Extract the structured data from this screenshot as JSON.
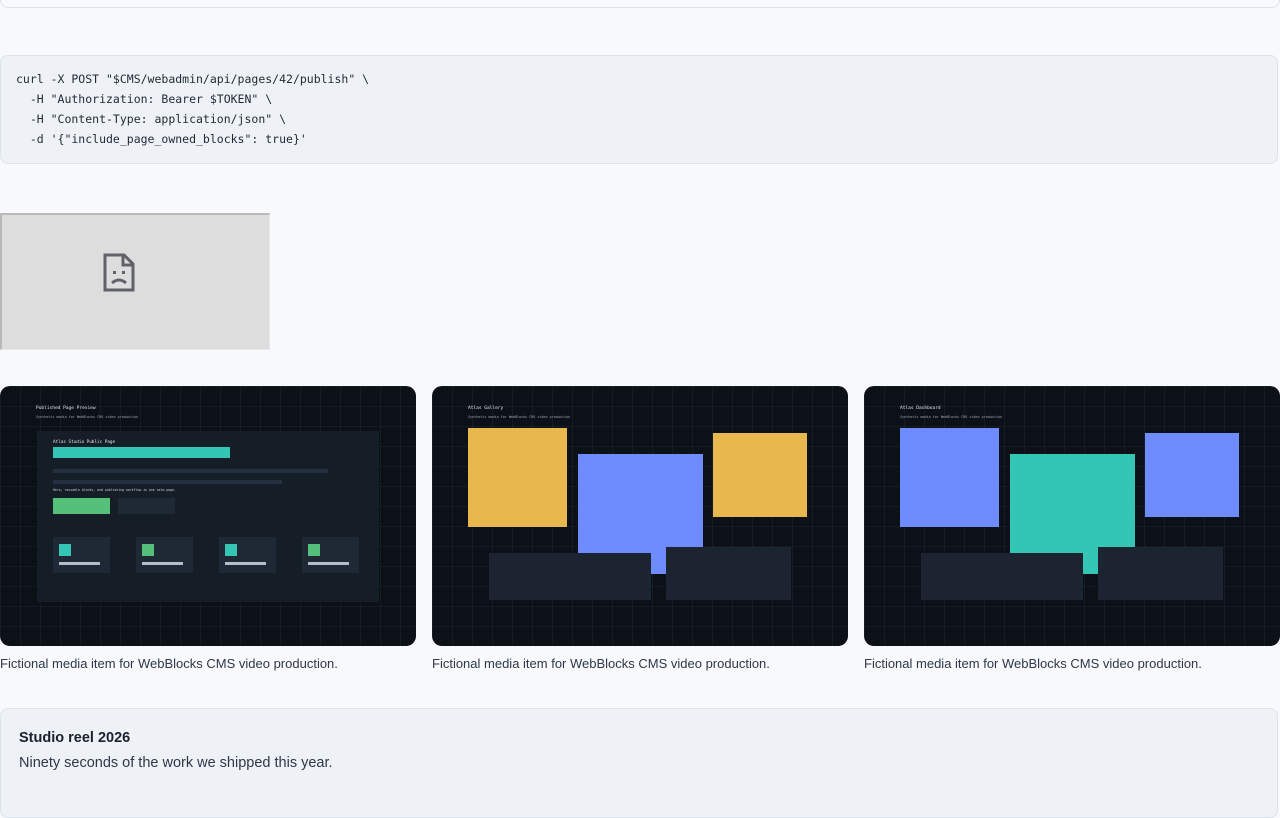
{
  "code_snippet": {
    "lines": [
      "curl -X POST \"$CMS/webadmin/api/pages/42/publish\" \\",
      "  -H \"Authorization: Bearer $TOKEN\" \\",
      "  -H \"Content-Type: application/json\" \\",
      "  -d '{\"include_page_owned_blocks\": true}'"
    ]
  },
  "broken_image": {
    "icon": "broken-image-icon"
  },
  "gallery": {
    "items": [
      {
        "thumb_title": "Published Page Preview",
        "thumb_subtitle": "Synthetic media for WebBlocks CMS video production",
        "inner_title": "Atlas Studio Public Page",
        "inner_text": "Hero, reusable blocks, and publishing workflow in one calm page.",
        "caption": "Fictional media item for WebBlocks CMS video production."
      },
      {
        "thumb_title": "Atlas Gallery",
        "thumb_subtitle": "Synthetic media for WebBlocks CMS video production",
        "caption": "Fictional media item for WebBlocks CMS video production."
      },
      {
        "thumb_title": "Atlas Dashboard",
        "thumb_subtitle": "Synthetic media for WebBlocks CMS video production",
        "caption": "Fictional media item for WebBlocks CMS video production."
      }
    ]
  },
  "feature_panel": {
    "title": "Studio reel 2026",
    "description": "Ninety seconds of the work we shipped this year."
  },
  "colors": {
    "teal": "#33c6b5",
    "green": "#55c07a",
    "amber": "#e8b84f",
    "periwinkle": "#6e8bff",
    "dark_block": "#1b2430",
    "thumb_bg": "#0c1118"
  }
}
